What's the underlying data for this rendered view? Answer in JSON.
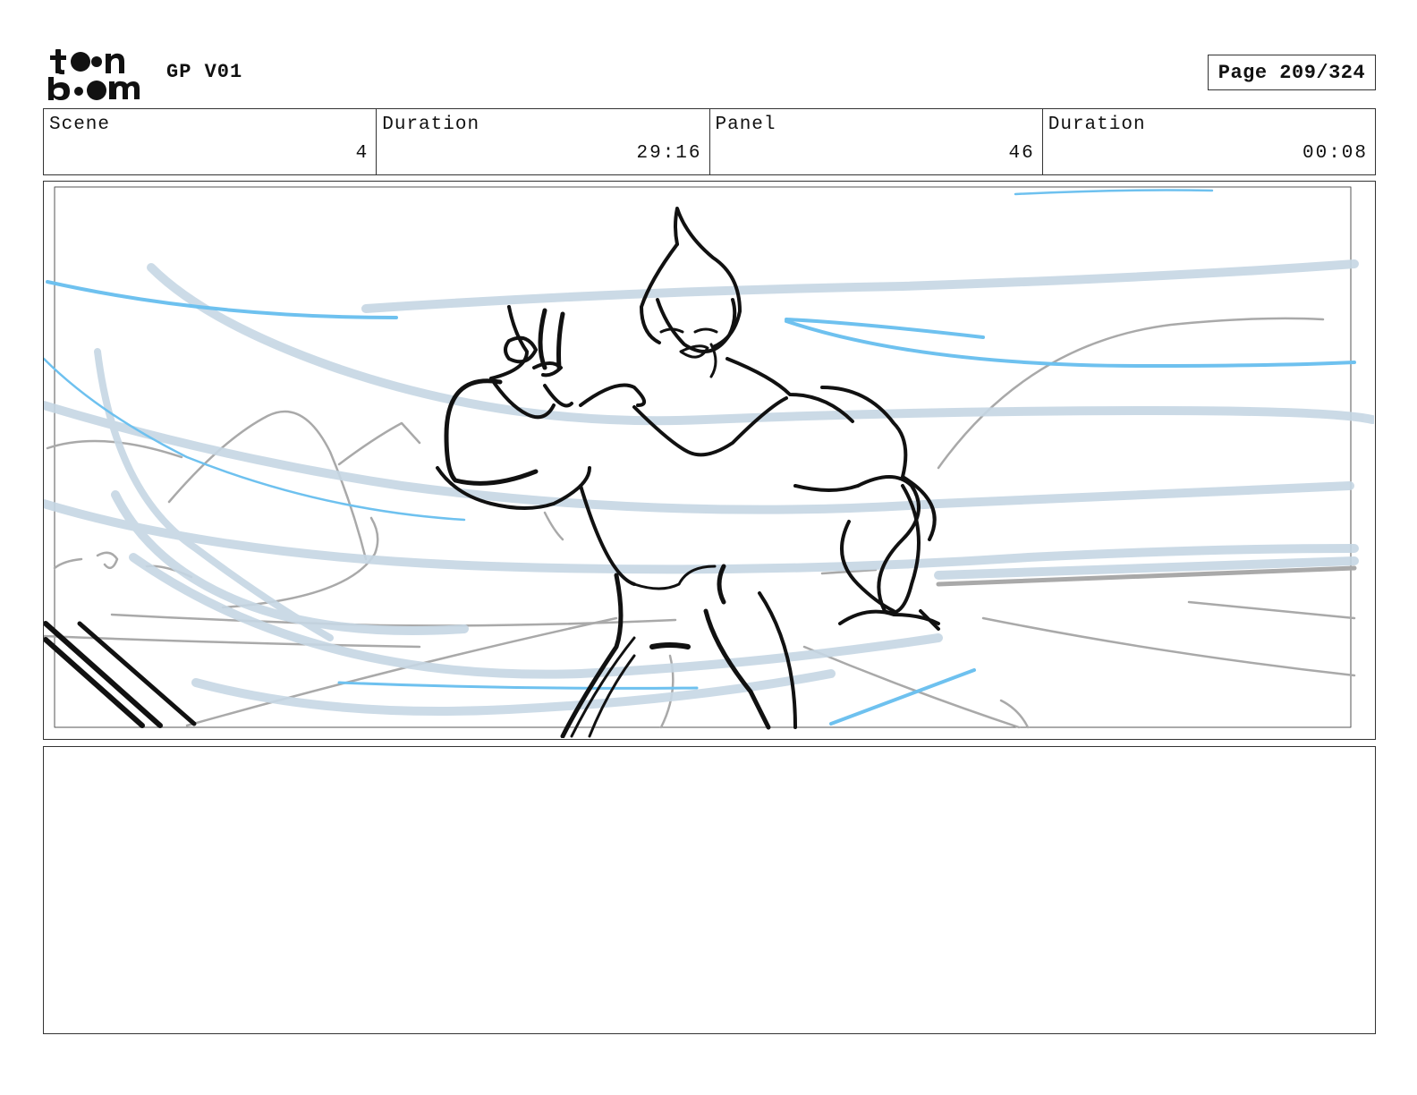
{
  "header": {
    "logo_text": "toon boom",
    "project": "GP V01",
    "page": "Page 209/324"
  },
  "info": {
    "scene_label": "Scene",
    "scene_value": "4",
    "scene_duration_label": "Duration",
    "scene_duration_value": "29:16",
    "panel_label": "Panel",
    "panel_value": "46",
    "panel_duration_label": "Duration",
    "panel_duration_value": "00:08"
  },
  "colors": {
    "line": "#111111",
    "wind_light": "#c6d7e4",
    "wind_bright": "#6ec1ef",
    "bg_grey": "#a9a9a9"
  },
  "notes": {
    "text": ""
  }
}
